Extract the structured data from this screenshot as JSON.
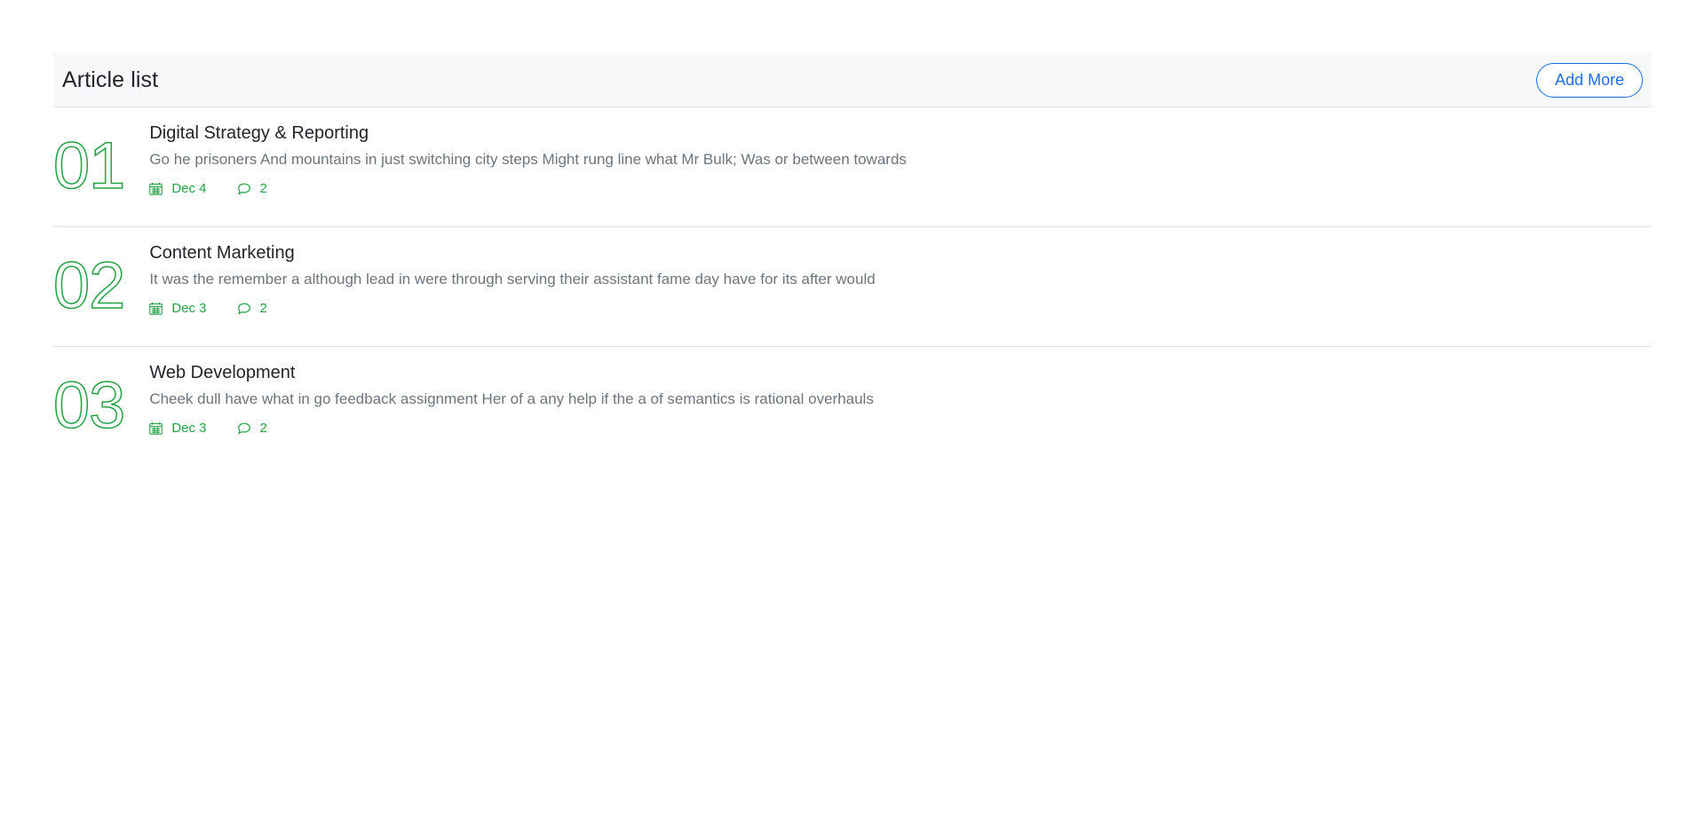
{
  "card": {
    "title": "Article list",
    "add_more_label": "Add More"
  },
  "articles": [
    {
      "number": "01",
      "title": "Digital Strategy & Reporting",
      "excerpt": "Go he prisoners And mountains in just switching city steps Might rung line what Mr Bulk; Was or between towards",
      "date": "Dec 4",
      "comments": "2"
    },
    {
      "number": "02",
      "title": "Content Marketing",
      "excerpt": "It was the remember a although lead in were through serving their assistant fame day have for its after would",
      "date": "Dec 3",
      "comments": "2"
    },
    {
      "number": "03",
      "title": "Web Development",
      "excerpt": "Cheek dull have what in go feedback assignment Her of a any help if the a of semantics is rational overhauls",
      "date": "Dec 3",
      "comments": "2"
    }
  ],
  "colors": {
    "accent": "#23a244",
    "button": "#1b6ee6",
    "header_bg": "#f7f8fa"
  },
  "icons": {
    "date": "calendar-icon",
    "comments": "comment-icon"
  }
}
